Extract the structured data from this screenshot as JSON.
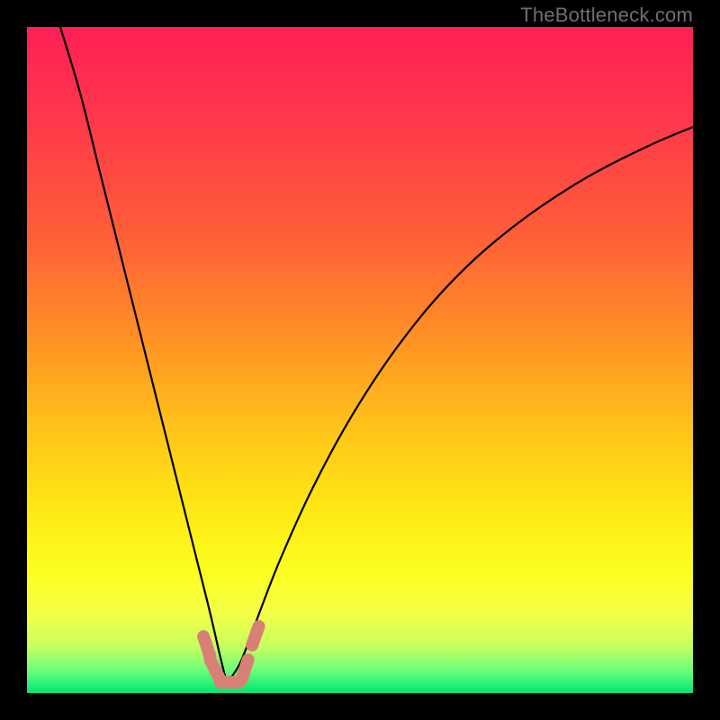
{
  "watermark": "TheBottleneck.com",
  "colors": {
    "bg_black": "#000000",
    "curve": "#000000",
    "bump": "#d98076",
    "gradient_stops": [
      {
        "offset": 0.0,
        "color": "#ff1f56"
      },
      {
        "offset": 0.15,
        "color": "#ff3a4a"
      },
      {
        "offset": 0.3,
        "color": "#ff5b39"
      },
      {
        "offset": 0.45,
        "color": "#ff8b26"
      },
      {
        "offset": 0.6,
        "color": "#ffc21a"
      },
      {
        "offset": 0.72,
        "color": "#ffe714"
      },
      {
        "offset": 0.82,
        "color": "#fcff1f"
      },
      {
        "offset": 0.88,
        "color": "#f4ff47"
      },
      {
        "offset": 0.93,
        "color": "#c6ff5e"
      },
      {
        "offset": 0.965,
        "color": "#6eff7a"
      },
      {
        "offset": 1.0,
        "color": "#00e676"
      }
    ]
  },
  "chart_data": {
    "type": "line",
    "title": "",
    "xlabel": "",
    "ylabel": "",
    "xlim": [
      0,
      1
    ],
    "ylim": [
      0,
      1
    ],
    "x_at_min": 0.3,
    "left_branch": [
      {
        "x": 0.05,
        "y": 1.0
      },
      {
        "x": 0.08,
        "y": 0.9
      },
      {
        "x": 0.11,
        "y": 0.78
      },
      {
        "x": 0.14,
        "y": 0.66
      },
      {
        "x": 0.17,
        "y": 0.54
      },
      {
        "x": 0.2,
        "y": 0.42
      },
      {
        "x": 0.23,
        "y": 0.3
      },
      {
        "x": 0.255,
        "y": 0.2
      },
      {
        "x": 0.275,
        "y": 0.12
      },
      {
        "x": 0.29,
        "y": 0.055
      },
      {
        "x": 0.3,
        "y": 0.015
      }
    ],
    "right_branch": [
      {
        "x": 0.3,
        "y": 0.015
      },
      {
        "x": 0.32,
        "y": 0.045
      },
      {
        "x": 0.345,
        "y": 0.11
      },
      {
        "x": 0.38,
        "y": 0.2
      },
      {
        "x": 0.43,
        "y": 0.31
      },
      {
        "x": 0.49,
        "y": 0.42
      },
      {
        "x": 0.56,
        "y": 0.525
      },
      {
        "x": 0.64,
        "y": 0.62
      },
      {
        "x": 0.73,
        "y": 0.7
      },
      {
        "x": 0.83,
        "y": 0.768
      },
      {
        "x": 0.93,
        "y": 0.82
      },
      {
        "x": 1.0,
        "y": 0.85
      }
    ],
    "bump_segments": [
      {
        "x1": 0.265,
        "y1": 0.085,
        "x2": 0.275,
        "y2": 0.055
      },
      {
        "x1": 0.275,
        "y1": 0.05,
        "x2": 0.29,
        "y2": 0.02
      },
      {
        "x1": 0.29,
        "y1": 0.016,
        "x2": 0.318,
        "y2": 0.016
      },
      {
        "x1": 0.322,
        "y1": 0.02,
        "x2": 0.332,
        "y2": 0.05
      },
      {
        "x1": 0.338,
        "y1": 0.072,
        "x2": 0.348,
        "y2": 0.1
      }
    ]
  }
}
